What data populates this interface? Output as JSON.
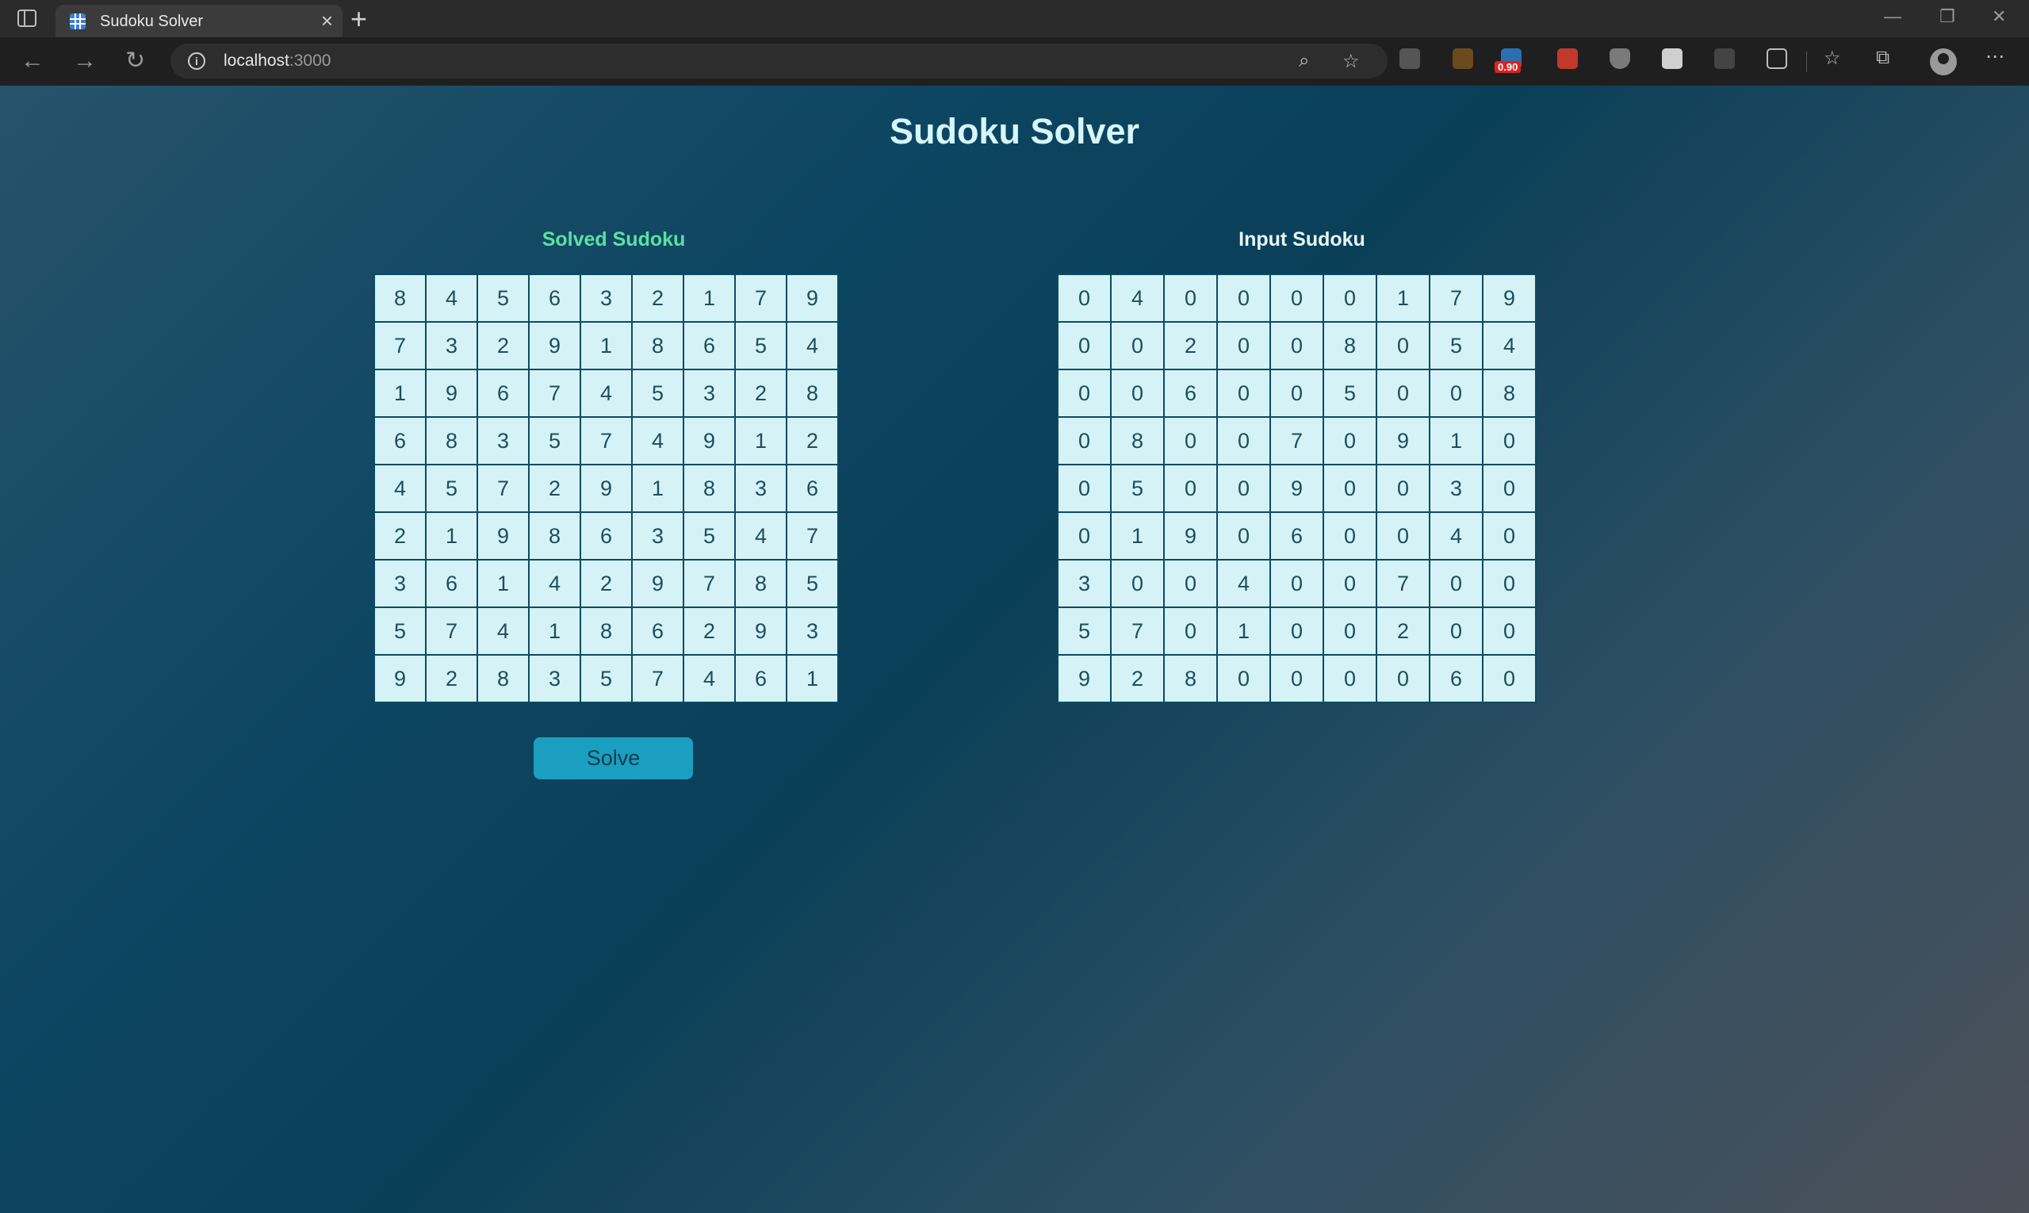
{
  "browser": {
    "tab_title": "Sudoku Solver",
    "url_host": "localhost",
    "url_port": ":3000",
    "extension_badge": "0.90"
  },
  "page": {
    "title": "Sudoku Solver",
    "solved_title": "Solved Sudoku",
    "input_title": "Input Sudoku",
    "solve_button": "Solve"
  },
  "colors": {
    "solved_title": "#5ce0a3",
    "cell_bg": "#d5f3f7",
    "button_bg": "#1a9fc0"
  },
  "solved_grid": [
    [
      8,
      4,
      5,
      6,
      3,
      2,
      1,
      7,
      9
    ],
    [
      7,
      3,
      2,
      9,
      1,
      8,
      6,
      5,
      4
    ],
    [
      1,
      9,
      6,
      7,
      4,
      5,
      3,
      2,
      8
    ],
    [
      6,
      8,
      3,
      5,
      7,
      4,
      9,
      1,
      2
    ],
    [
      4,
      5,
      7,
      2,
      9,
      1,
      8,
      3,
      6
    ],
    [
      2,
      1,
      9,
      8,
      6,
      3,
      5,
      4,
      7
    ],
    [
      3,
      6,
      1,
      4,
      2,
      9,
      7,
      8,
      5
    ],
    [
      5,
      7,
      4,
      1,
      8,
      6,
      2,
      9,
      3
    ],
    [
      9,
      2,
      8,
      3,
      5,
      7,
      4,
      6,
      1
    ]
  ],
  "input_grid": [
    [
      0,
      4,
      0,
      0,
      0,
      0,
      1,
      7,
      9
    ],
    [
      0,
      0,
      2,
      0,
      0,
      8,
      0,
      5,
      4
    ],
    [
      0,
      0,
      6,
      0,
      0,
      5,
      0,
      0,
      8
    ],
    [
      0,
      8,
      0,
      0,
      7,
      0,
      9,
      1,
      0
    ],
    [
      0,
      5,
      0,
      0,
      9,
      0,
      0,
      3,
      0
    ],
    [
      0,
      1,
      9,
      0,
      6,
      0,
      0,
      4,
      0
    ],
    [
      3,
      0,
      0,
      4,
      0,
      0,
      7,
      0,
      0
    ],
    [
      5,
      7,
      0,
      1,
      0,
      0,
      2,
      0,
      0
    ],
    [
      9,
      2,
      8,
      0,
      0,
      0,
      0,
      6,
      0
    ]
  ]
}
